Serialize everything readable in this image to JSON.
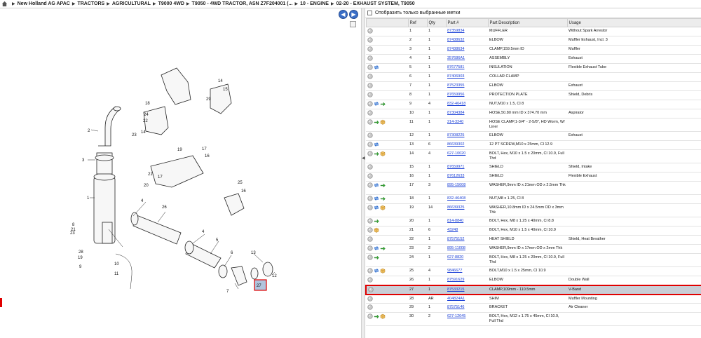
{
  "breadcrumb": [
    "New Holland AG APAC",
    "TRACTORS",
    "AGRICULTURAL",
    "T9000 4WD",
    "T9050 - 4WD TRACTOR, ASN Z7F204001 (...",
    "10 - ENGINE",
    "02-20 - EXHAUST SYSTEM, T9050"
  ],
  "filter": {
    "label": "Отобразить только выбранные метки"
  },
  "table": {
    "headers": [
      "",
      "Ref",
      "Qty",
      "Part #",
      "Part Description",
      "Usage"
    ],
    "rows": [
      {
        "icons": [
          "circle"
        ],
        "ref": "1",
        "qty": "1",
        "part": "87359834",
        "desc": "MUFFLER",
        "usage": "Without Spark Arrestor"
      },
      {
        "icons": [
          "circle"
        ],
        "ref": "2",
        "qty": "1",
        "part": "87438632",
        "desc": "ELBOW",
        "usage": "Muffler Exhaust, Incl. 3"
      },
      {
        "icons": [
          "circle"
        ],
        "ref": "3",
        "qty": "1",
        "part": "87438634",
        "desc": "CLAMP,159.5mm ID",
        "usage": "Muffler"
      },
      {
        "icons": [
          "circle"
        ],
        "ref": "4",
        "qty": "1",
        "part": "357686A1",
        "desc": "ASSEMBLY",
        "usage": "Exhaust"
      },
      {
        "icons": [
          "circle",
          "swap"
        ],
        "ref": "5",
        "qty": "1",
        "part": "87677581",
        "desc": "INSULATION",
        "usage": "Flexible Exhaust Tube"
      },
      {
        "icons": [
          "circle"
        ],
        "ref": "6",
        "qty": "1",
        "part": "87406903",
        "desc": "COLLAR CLAMP",
        "usage": ""
      },
      {
        "icons": [
          "circle"
        ],
        "ref": "7",
        "qty": "1",
        "part": "87523355",
        "desc": "ELBOW",
        "usage": "Exhaust"
      },
      {
        "icons": [
          "circle"
        ],
        "ref": "8",
        "qty": "1",
        "part": "87659956",
        "desc": "PROTECTION PLATE",
        "usage": "Shield, Debris"
      },
      {
        "icons": [
          "circle",
          "swap",
          "arrow"
        ],
        "ref": "9",
        "qty": "4",
        "part": "832-46418",
        "desc": "NUT,M10 x 1.5, Cl 8",
        "usage": ""
      },
      {
        "icons": [
          "circle"
        ],
        "ref": "10",
        "qty": "1",
        "part": "87304384",
        "desc": "HOSE,50.80 mm ID x 374.70 mm",
        "usage": "Aspirator"
      },
      {
        "icons": [
          "circle",
          "arrow",
          "box"
        ],
        "ref": "11",
        "qty": "1",
        "part": "214-3240",
        "desc": "HOSE CLAMP,1-3/4\" - 2-5/8\", HD Worm, W/ Liner",
        "usage": "",
        "tall": true
      },
      {
        "icons": [
          "circle"
        ],
        "ref": "12",
        "qty": "1",
        "part": "87308225",
        "desc": "ELBOW",
        "usage": "Exhaust"
      },
      {
        "icons": [
          "circle",
          "swap"
        ],
        "ref": "13",
        "qty": "6",
        "part": "86639302",
        "desc": "12 PT SCREW,M10 x 25mm, Cl 12.9",
        "usage": ""
      },
      {
        "icons": [
          "circle",
          "arrow",
          "box"
        ],
        "ref": "14",
        "qty": "4",
        "part": "627-10020",
        "desc": "BOLT, Hex, M10 x 1.5 x 20mm, Cl 10.9, Full Thd",
        "usage": "",
        "tall": true
      },
      {
        "icons": [
          "circle"
        ],
        "ref": "15",
        "qty": "1",
        "part": "87659971",
        "desc": "SHIELD",
        "usage": "Shield, Intake"
      },
      {
        "icons": [
          "circle"
        ],
        "ref": "16",
        "qty": "1",
        "part": "87612633",
        "desc": "SHIELD",
        "usage": "Flexible Exhaust"
      },
      {
        "icons": [
          "circle",
          "swap",
          "arrow"
        ],
        "ref": "17",
        "qty": "3",
        "part": "895-15008",
        "desc": "WASHER,9mm ID x 21mm OD x 2.5mm Thk",
        "usage": "",
        "tall": true
      },
      {
        "icons": [
          "circle",
          "swap",
          "arrow"
        ],
        "ref": "18",
        "qty": "1",
        "part": "832-46408",
        "desc": "NUT,M8 x 1.25, Cl 8",
        "usage": ""
      },
      {
        "icons": [
          "circle",
          "swap",
          "box"
        ],
        "ref": "19",
        "qty": "14",
        "part": "86639325",
        "desc": "WASHER,10.8mm ID x 24.5mm OD x 3mm Thk",
        "usage": "",
        "tall": true
      },
      {
        "icons": [
          "circle",
          "arrow"
        ],
        "ref": "20",
        "qty": "1",
        "part": "814-8840",
        "desc": "BOLT, Hex, M8 x 1.25 x 40mm, Cl 8.8",
        "usage": ""
      },
      {
        "icons": [
          "circle",
          "box"
        ],
        "ref": "21",
        "qty": "6",
        "part": "43248",
        "desc": "BOLT, Hex, M10 x 1.5 x 40mm, Cl 10.9",
        "usage": ""
      },
      {
        "icons": [
          "circle"
        ],
        "ref": "22",
        "qty": "1",
        "part": "87575152",
        "desc": "HEAT SHIELD",
        "usage": "Shield, Heat Breather"
      },
      {
        "icons": [
          "circle",
          "swap",
          "arrow"
        ],
        "ref": "23",
        "qty": "2",
        "part": "895-11008",
        "desc": "WASHER,9mm ID x 17mm OD x 2mm Thk",
        "usage": ""
      },
      {
        "icons": [
          "circle",
          "arrow"
        ],
        "ref": "24",
        "qty": "1",
        "part": "627-8820",
        "desc": "BOLT, Hex, M8 x 1.25 x 20mm, Cl 10.9, Full Thd",
        "usage": "",
        "tall": true
      },
      {
        "icons": [
          "circle",
          "swap",
          "box"
        ],
        "ref": "25",
        "qty": "4",
        "part": "9846677",
        "desc": "BOLT,M10 x 1.5 x 25mm, Cl 10.9",
        "usage": ""
      },
      {
        "icons": [
          "circle"
        ],
        "ref": "26",
        "qty": "1",
        "part": "87591629",
        "desc": "ELBOW",
        "usage": "Double Wall"
      },
      {
        "icons": [
          "circle"
        ],
        "ref": "27",
        "qty": "1",
        "part": "87533215",
        "desc": "CLAMP,109mm - 110.5mm",
        "usage": "V-Band",
        "selected": true
      },
      {
        "icons": [
          "circle"
        ],
        "ref": "28",
        "qty": "AR",
        "part": "404824A1",
        "desc": "SHIM",
        "usage": "Muffler Mounting"
      },
      {
        "icons": [
          "circle"
        ],
        "ref": "29",
        "qty": "1",
        "part": "87575146",
        "desc": "BRACKET",
        "usage": "Air Cleaner"
      },
      {
        "icons": [
          "circle",
          "arrow",
          "box"
        ],
        "ref": "30",
        "qty": "2",
        "part": "627-12045",
        "desc": "BOLT, Hex, M12 x 1.75 x 45mm, Cl 10.9, Full Thd",
        "usage": "",
        "tall": true
      }
    ]
  },
  "diagram": {
    "callouts": [
      "1",
      "2",
      "3",
      "4",
      "4",
      "5",
      "6",
      "7",
      "8",
      "9",
      "10",
      "11",
      "12",
      "13",
      "14",
      "14",
      "15",
      "16",
      "17",
      "17",
      "18",
      "19",
      "19",
      "20",
      "21",
      "21",
      "22",
      "23",
      "23",
      "24",
      "25",
      "26",
      "27",
      "28",
      "29"
    ],
    "selected_callout": "27"
  }
}
